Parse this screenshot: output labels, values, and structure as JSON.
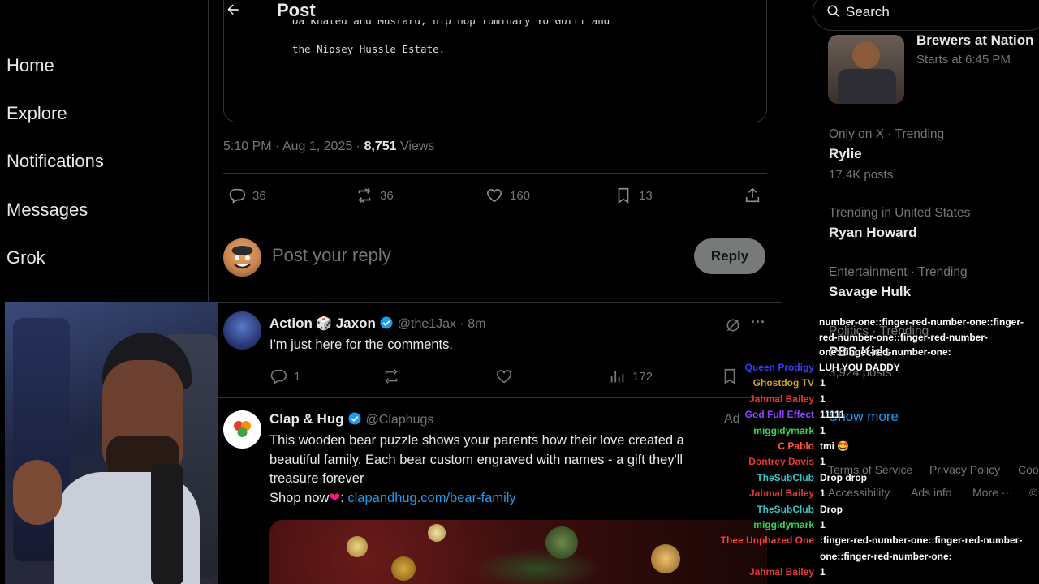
{
  "nav": {
    "items": [
      {
        "label": "Home"
      },
      {
        "label": "Explore"
      },
      {
        "label": "Notifications"
      },
      {
        "label": "Messages"
      },
      {
        "label": "Grok"
      }
    ]
  },
  "header": {
    "title": "Post",
    "back_icon": "arrow-left-icon"
  },
  "quoted": {
    "line1": "Da Khaled and Mustard, hip hop luminary Yo Gotti and",
    "line2": "the Nipsey Hussle Estate."
  },
  "post_meta": {
    "time": "5:10 PM",
    "sep1": " · ",
    "date": "Aug 1, 2025",
    "sep2": " · ",
    "views_count": "8,751",
    "views_label": " Views"
  },
  "post_actions": {
    "replies": "36",
    "reposts": "36",
    "likes": "160",
    "bookmarks": "13"
  },
  "reply_box": {
    "placeholder": "Post your reply",
    "button": "Reply"
  },
  "replies": [
    {
      "name_part1": "Action",
      "name_emoji": "🎲",
      "name_part2": "Jaxon",
      "handle": "@the1Jax",
      "time": "8m",
      "text": "I'm just here for the comments.",
      "replies": "1",
      "views": "172"
    },
    {
      "name": "Clap & Hug",
      "handle": "@Claphugs",
      "ad_label": "Ad",
      "text1": "This wooden bear puzzle shows your parents how their love created a",
      "text2": "beautiful family. Each bear custom engraved with names - a gift they'll",
      "text3": "treasure forever",
      "shop_text": "Shop now",
      "link": "clapandhug.com/bear-family"
    }
  ],
  "search": {
    "placeholder": "Search"
  },
  "sidebar": {
    "event_title": "Brewers at Nation",
    "event_time": "Starts at 6:45 PM",
    "trends": [
      {
        "category": "Only on X · Trending",
        "name": "Rylie",
        "count": "17.4K posts"
      },
      {
        "category": "Trending in United States",
        "name": "Ryan Howard"
      },
      {
        "category": "Entertainment · Trending",
        "name": "Savage Hulk"
      },
      {
        "category": "Politics · Trending",
        "name": "PBS Kids",
        "count": "3,924 posts"
      }
    ],
    "show_more": "Show more",
    "footer": [
      "Terms of Service",
      "Privacy Policy",
      "Coo",
      "Accessibility",
      "Ads info",
      "More ···",
      "©"
    ]
  },
  "chat": {
    "overflow_lines": [
      "number-one::finger-red-number-one::finger-",
      "red-number-one::finger-red-number-",
      "one::finger-red-number-one:",
      "LUH YOU DADDY"
    ],
    "messages": [
      {
        "user": "Queen Prodigy",
        "color": "#3a3aff",
        "msg": ""
      },
      {
        "user": "Ghostdog TV",
        "color": "#c9a227",
        "msg": "1"
      },
      {
        "user": "Jahmal Bailey",
        "color": "#e53935",
        "msg": "1"
      },
      {
        "user": "God Full Effect",
        "color": "#8e44ff",
        "msg": "11111"
      },
      {
        "user": "miggidymark",
        "color": "#39d353",
        "msg": "1"
      },
      {
        "user": "C Pablo",
        "color": "#ff5a36",
        "msg": "tmi 🤩"
      },
      {
        "user": "Dontrey Davis",
        "color": "#e53935",
        "msg": "1"
      },
      {
        "user": "TheSubClub",
        "color": "#36c5c5",
        "msg": "Drop drop"
      },
      {
        "user": "Jahmal Bailey",
        "color": "#e53935",
        "msg": "1"
      },
      {
        "user": "TheSubClub",
        "color": "#36c5c5",
        "msg": "Drop"
      },
      {
        "user": "miggidymark",
        "color": "#39d353",
        "msg": "1"
      },
      {
        "user": "Thee Unphazed One",
        "color": "#ff3d3d",
        "msg": ":finger-red-number-one::finger-red-number-"
      },
      {
        "user": "",
        "color": "#ffffff",
        "msg": "one::finger-red-number-one:"
      },
      {
        "user": "Jahmal Bailey",
        "color": "#e53935",
        "msg": "1"
      }
    ]
  },
  "colors": {
    "accent": "#1d9bf0",
    "background": "#000000",
    "muted": "#71767b",
    "text": "#e7e9ea"
  }
}
